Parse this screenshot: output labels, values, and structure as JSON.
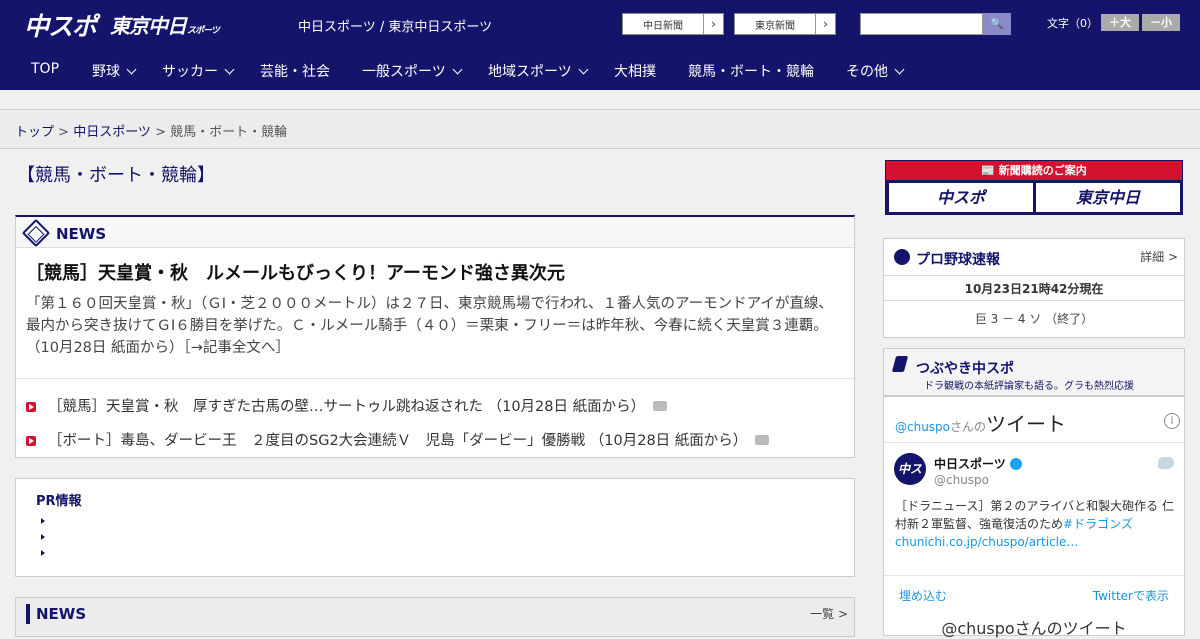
{
  "header": {
    "logo_chuspo": "中スポ",
    "logo_tokyo": "東京中日",
    "logo_tokyo_small": "スポーツ",
    "site_title": "中日スポーツ / 東京中日スポーツ",
    "select1": "中日新聞",
    "select2": "東京新聞",
    "fontsize_label": "文字（0）",
    "fontsize_up": "＋大",
    "fontsize_down": "－小"
  },
  "nav": {
    "items": [
      {
        "label": "TOP"
      },
      {
        "label": "野球"
      },
      {
        "label": "サッカー"
      },
      {
        "label": "芸能・社会"
      },
      {
        "label": "一般スポーツ"
      },
      {
        "label": "地域スポーツ"
      },
      {
        "label": "大相撲"
      },
      {
        "label": "競馬・ボート・競輪"
      },
      {
        "label": "その他"
      }
    ]
  },
  "breadcrumb": {
    "top": "トップ",
    "sep": " > ",
    "chunichi": "中日スポーツ",
    "current": "競馬・ボート・競輪"
  },
  "page_title": "【競馬・ボート・競輪】",
  "news": {
    "title": "NEWS",
    "headline": "［競馬］天皇賞・秋　ルメールもびっくり！アーモンド強さ異次元",
    "lead": "「第１６０回天皇賞・秋」（ＧⅠ・芝２０００メートル）は２７日、東京競馬場で行われ、１番人気のアーモンドアイが直線、最内から突き抜けてＧⅠ６勝目を挙げた。Ｃ・ルメール騎手（４０）＝栗東・フリー＝は昨年秋、今春に続く天皇賞３連覇。（10月28日 紙面から）",
    "lead_more": "［→記事全文へ］",
    "rows": [
      {
        "text": "［競馬］天皇賞・秋　厚すぎた古馬の壁…サートゥル跳ね返された",
        "date": "（10月28日 紙面から）"
      },
      {
        "text": "［ボート］毒島、ダービー王　２度目のSG2大会連続Ｖ　児島「ダービー」優勝戦",
        "date": "（10月28日 紙面から）"
      }
    ]
  },
  "pr": {
    "title": "PR情報"
  },
  "news2": {
    "title": "NEWS",
    "more": "一覧 >"
  },
  "subscription": {
    "banner": "新聞購読のご案内",
    "chuspo": "中スポ",
    "tokyo": "東京中日"
  },
  "baseball": {
    "title": "プロ野球速報",
    "detail": "詳細 >",
    "time": "10月23日21時42分現在",
    "score": "巨 3 － 4 ソ （終了）"
  },
  "tweets": {
    "title": "つぶやき中スポ",
    "subtitle": "ドラ観戦の本紙評論家も語る。グラも熱烈応援",
    "handle": "@chuspo",
    "handle_suffix": "さんの",
    "handle_title": "ツイート",
    "info": "i",
    "name": "中日スポーツ",
    "user": "@chuspo",
    "avatar": "中スポ",
    "body": "［ドラニュース］第２のアライバと和製大砲作る 仁村新２軍監督、強竜復活のため",
    "body_link": "#ドラゴンズchunichi.co.jp/chuspo/article…",
    "embed": "埋め込む",
    "view": "Twitterで表示",
    "footer": "@chuspoさんのツイート"
  },
  "colors": {
    "brand_navy": "#14146b",
    "accent_red": "#d4122f",
    "twitter_blue": "#1b95e0"
  }
}
